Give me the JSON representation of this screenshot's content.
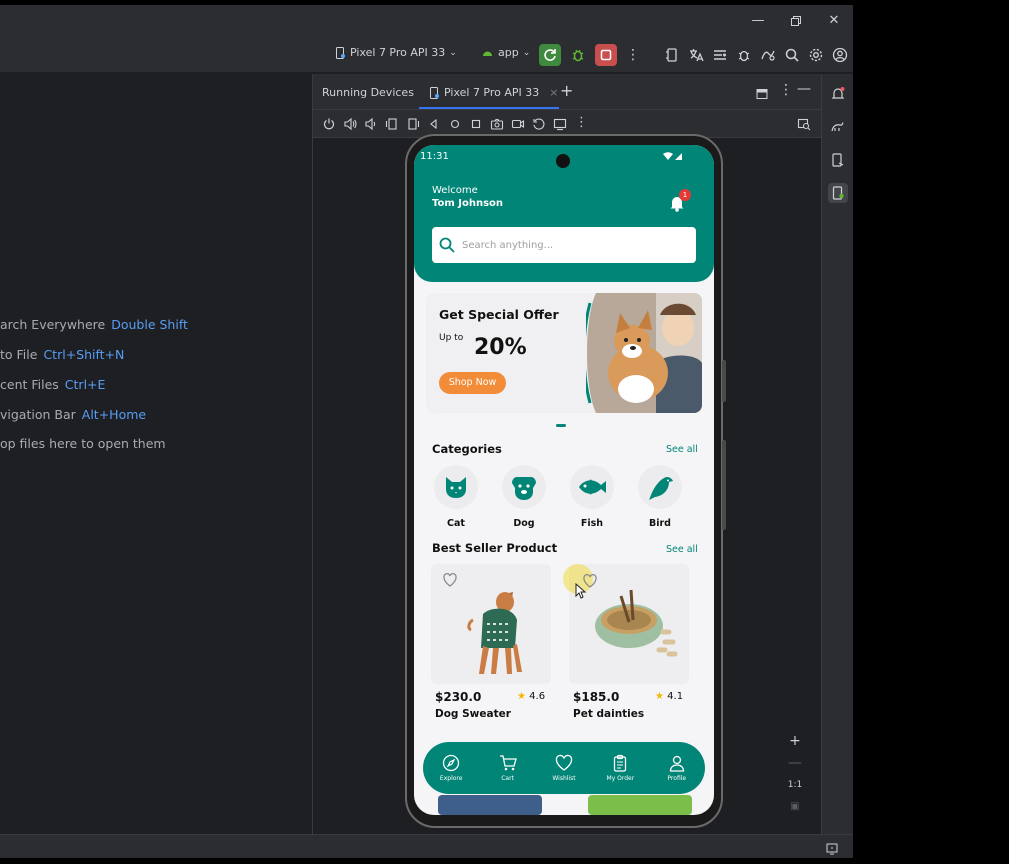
{
  "ide": {
    "device_selector": "Pixel 7 Pro API 33",
    "run_config": "app",
    "running_devices_title": "Running Devices",
    "device_tab": "Pixel 7 Pro API 33",
    "hints": [
      {
        "label": "arch Everywhere",
        "key": "Double Shift"
      },
      {
        "label": " to File",
        "key": "Ctrl+Shift+N"
      },
      {
        "label": "cent Files",
        "key": "Ctrl+E"
      },
      {
        "label": "vigation Bar",
        "key": "Alt+Home"
      },
      {
        "label": "op files here to open them",
        "key": ""
      }
    ],
    "zoom_reset": "1:1",
    "accent_color": "#3574f0"
  },
  "app": {
    "status_time": "11:31",
    "welcome": "Welcome",
    "user_name": "Tom Johnson",
    "notification_count": "1",
    "search_placeholder": "Search anything...",
    "banner": {
      "title": "Get Special Offer",
      "upto": "Up to",
      "percent": "20%",
      "button": "Shop Now"
    },
    "categories_title": "Categories",
    "see_all": "See all",
    "categories": [
      {
        "label": "Cat",
        "icon": "cat-icon"
      },
      {
        "label": "Dog",
        "icon": "dog-icon"
      },
      {
        "label": "Fish",
        "icon": "fish-icon"
      },
      {
        "label": "Bird",
        "icon": "bird-icon"
      }
    ],
    "best_seller_title": "Best Seller Product",
    "products": [
      {
        "price": "$230.0",
        "rating": "4.6",
        "name": "Dog Sweater"
      },
      {
        "price": "$185.0",
        "rating": "4.1",
        "name": "Pet dainties"
      }
    ],
    "nav": [
      {
        "label": "Explore",
        "icon": "compass-icon"
      },
      {
        "label": "Cart",
        "icon": "cart-icon"
      },
      {
        "label": "Wishlist",
        "icon": "heart-icon"
      },
      {
        "label": "My Order",
        "icon": "clipboard-icon"
      },
      {
        "label": "Profile",
        "icon": "user-icon"
      }
    ],
    "brand_color": "#008577",
    "offer_color": "#f28c38"
  }
}
